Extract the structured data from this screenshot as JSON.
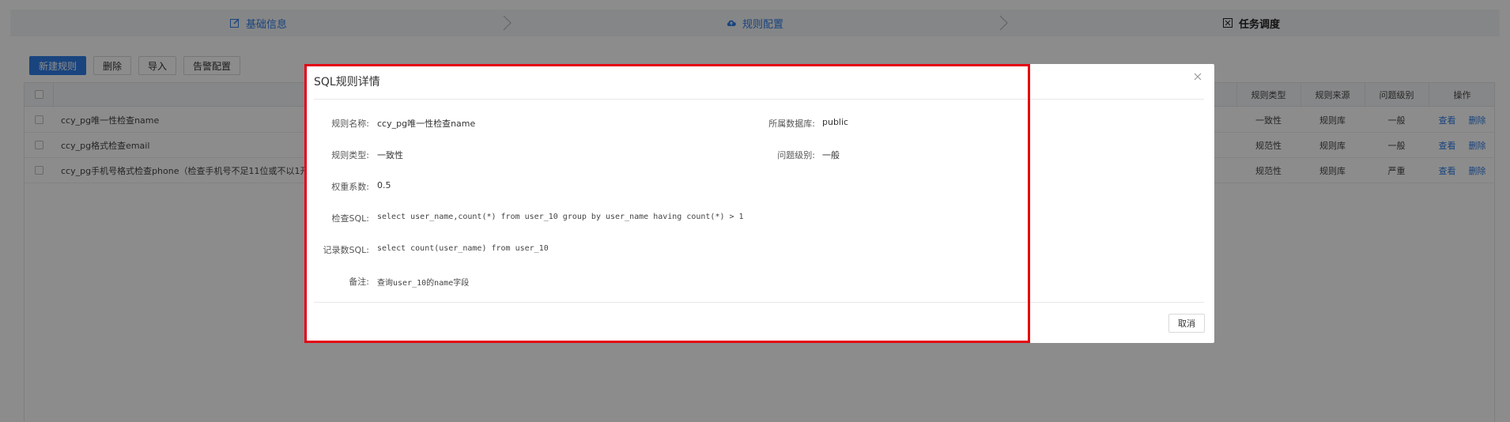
{
  "steps": [
    {
      "label": "基础信息",
      "icon": "edit-icon"
    },
    {
      "label": "规则配置",
      "icon": "cloud-upload-icon"
    },
    {
      "label": "任务调度",
      "icon": "schedule-icon"
    }
  ],
  "toolbar": {
    "new_label": "新建规则",
    "delete_label": "删除",
    "import_label": "导入",
    "alert_label": "告警配置"
  },
  "table": {
    "columns": [
      "规则类型",
      "规则来源",
      "问题级别",
      "操作"
    ],
    "rows": [
      {
        "name": "ccy_pg唯一性检查name",
        "type": "一致性",
        "source": "规则库",
        "level": "一般"
      },
      {
        "name": "ccy_pg格式检查email",
        "type": "规范性",
        "source": "规则库",
        "level": "一般"
      },
      {
        "name": "ccy_pg手机号格式检查phone（检查手机号不足11位或不以1开",
        "type": "规范性",
        "source": "规则库",
        "level": "严重"
      }
    ],
    "actions": {
      "view": "查看",
      "delete": "删除"
    }
  },
  "modal": {
    "title": "SQL规则详情",
    "fields": {
      "rule_name": {
        "label": "规则名称:",
        "value": "ccy_pg唯一性检查name"
      },
      "database": {
        "label": "所属数据库:",
        "value": "public"
      },
      "rule_type": {
        "label": "规则类型:",
        "value": "一致性"
      },
      "issue_level": {
        "label": "问题级别:",
        "value": "一般"
      },
      "weight": {
        "label": "权重系数:",
        "value": "0.5"
      },
      "check_sql": {
        "label": "检查SQL:",
        "value": "select user_name,count(*) from user_10 group by user_name having count(*) > 1"
      },
      "count_sql": {
        "label": "记录数SQL:",
        "value": "select count(user_name) from user_10"
      },
      "remark": {
        "label": "备注:",
        "value": "查询user_10的name字段"
      }
    },
    "cancel_label": "取消"
  },
  "colors": {
    "primary": "#2f7ce6",
    "highlight": "#e60012",
    "overlay": "rgba(0,0,0,0.45)"
  }
}
